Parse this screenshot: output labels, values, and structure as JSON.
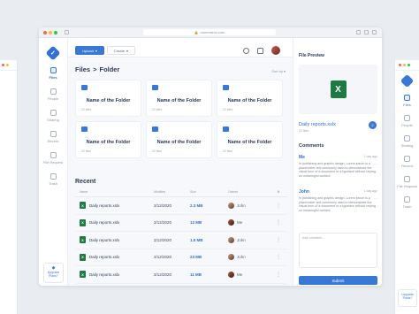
{
  "browser": {
    "url": "moreoreon.com"
  },
  "nav": {
    "items": [
      {
        "label": "Files"
      },
      {
        "label": "People"
      },
      {
        "label": "Sharing"
      },
      {
        "label": "Recent"
      },
      {
        "label": "File Request"
      },
      {
        "label": "Trash"
      }
    ],
    "upgrade_line1": "Upgrade",
    "upgrade_line2": "Plans?"
  },
  "toolbar": {
    "upload_label": "Upload",
    "create_label": "Create"
  },
  "breadcrumb": {
    "root": "Files",
    "sep": ">",
    "current": "Folder"
  },
  "sort_label": "Sort by",
  "folders": [
    {
      "name": "Name of the Folder",
      "count": "22 files"
    },
    {
      "name": "Name of the Folder",
      "count": "22 files"
    },
    {
      "name": "Name of the Folder",
      "count": "22 files"
    },
    {
      "name": "Name of the Folder",
      "count": "22 files"
    },
    {
      "name": "Name of the Folder",
      "count": "22 files"
    },
    {
      "name": "Name of the Folder",
      "count": "22 files"
    }
  ],
  "recent": {
    "title": "Recent",
    "headers": {
      "name": "Name",
      "modified": "Modified",
      "size": "Size",
      "owner": "Owned"
    },
    "rows": [
      {
        "name": "Daily reports.xslx",
        "modified": "2/12/2020",
        "size": "2.3 MB",
        "owner": "John"
      },
      {
        "name": "Daily reports.xslx",
        "modified": "2/12/2020",
        "size": "12 MB",
        "owner": "Me"
      },
      {
        "name": "Daily reports.xslx",
        "modified": "2/12/2020",
        "size": "1.5 MB",
        "owner": "John"
      },
      {
        "name": "Daily reports.xslx",
        "modified": "2/12/2020",
        "size": "23 MB",
        "owner": "John"
      },
      {
        "name": "Daily reports.xslx",
        "modified": "2/12/2020",
        "size": "11 MB",
        "owner": "Me"
      }
    ]
  },
  "preview": {
    "title": "File Preview",
    "file_name": "Daily reports.xslx",
    "file_meta": "22 files",
    "badge": "2"
  },
  "comments": {
    "title": "Comments",
    "items": [
      {
        "author": "Me",
        "time": "1 day ago",
        "text": "In publishing and graphic design, Lorem ipsum is a placeholder text commonly used to demonstrate the visual form of a document or a typeface without relying on meaningful content."
      },
      {
        "author": "John",
        "time": "1 day ago",
        "text": "In publishing and graphic design, Lorem ipsum is a placeholder text commonly used to demonstrate the visual form of a document or a typeface without relying on meaningful content."
      }
    ],
    "placeholder": "Add comment...",
    "submit_label": "Submit"
  },
  "colors": {
    "accent": "#3a78d6",
    "excel": "#1f7a44",
    "background": "#e9ecf1"
  }
}
